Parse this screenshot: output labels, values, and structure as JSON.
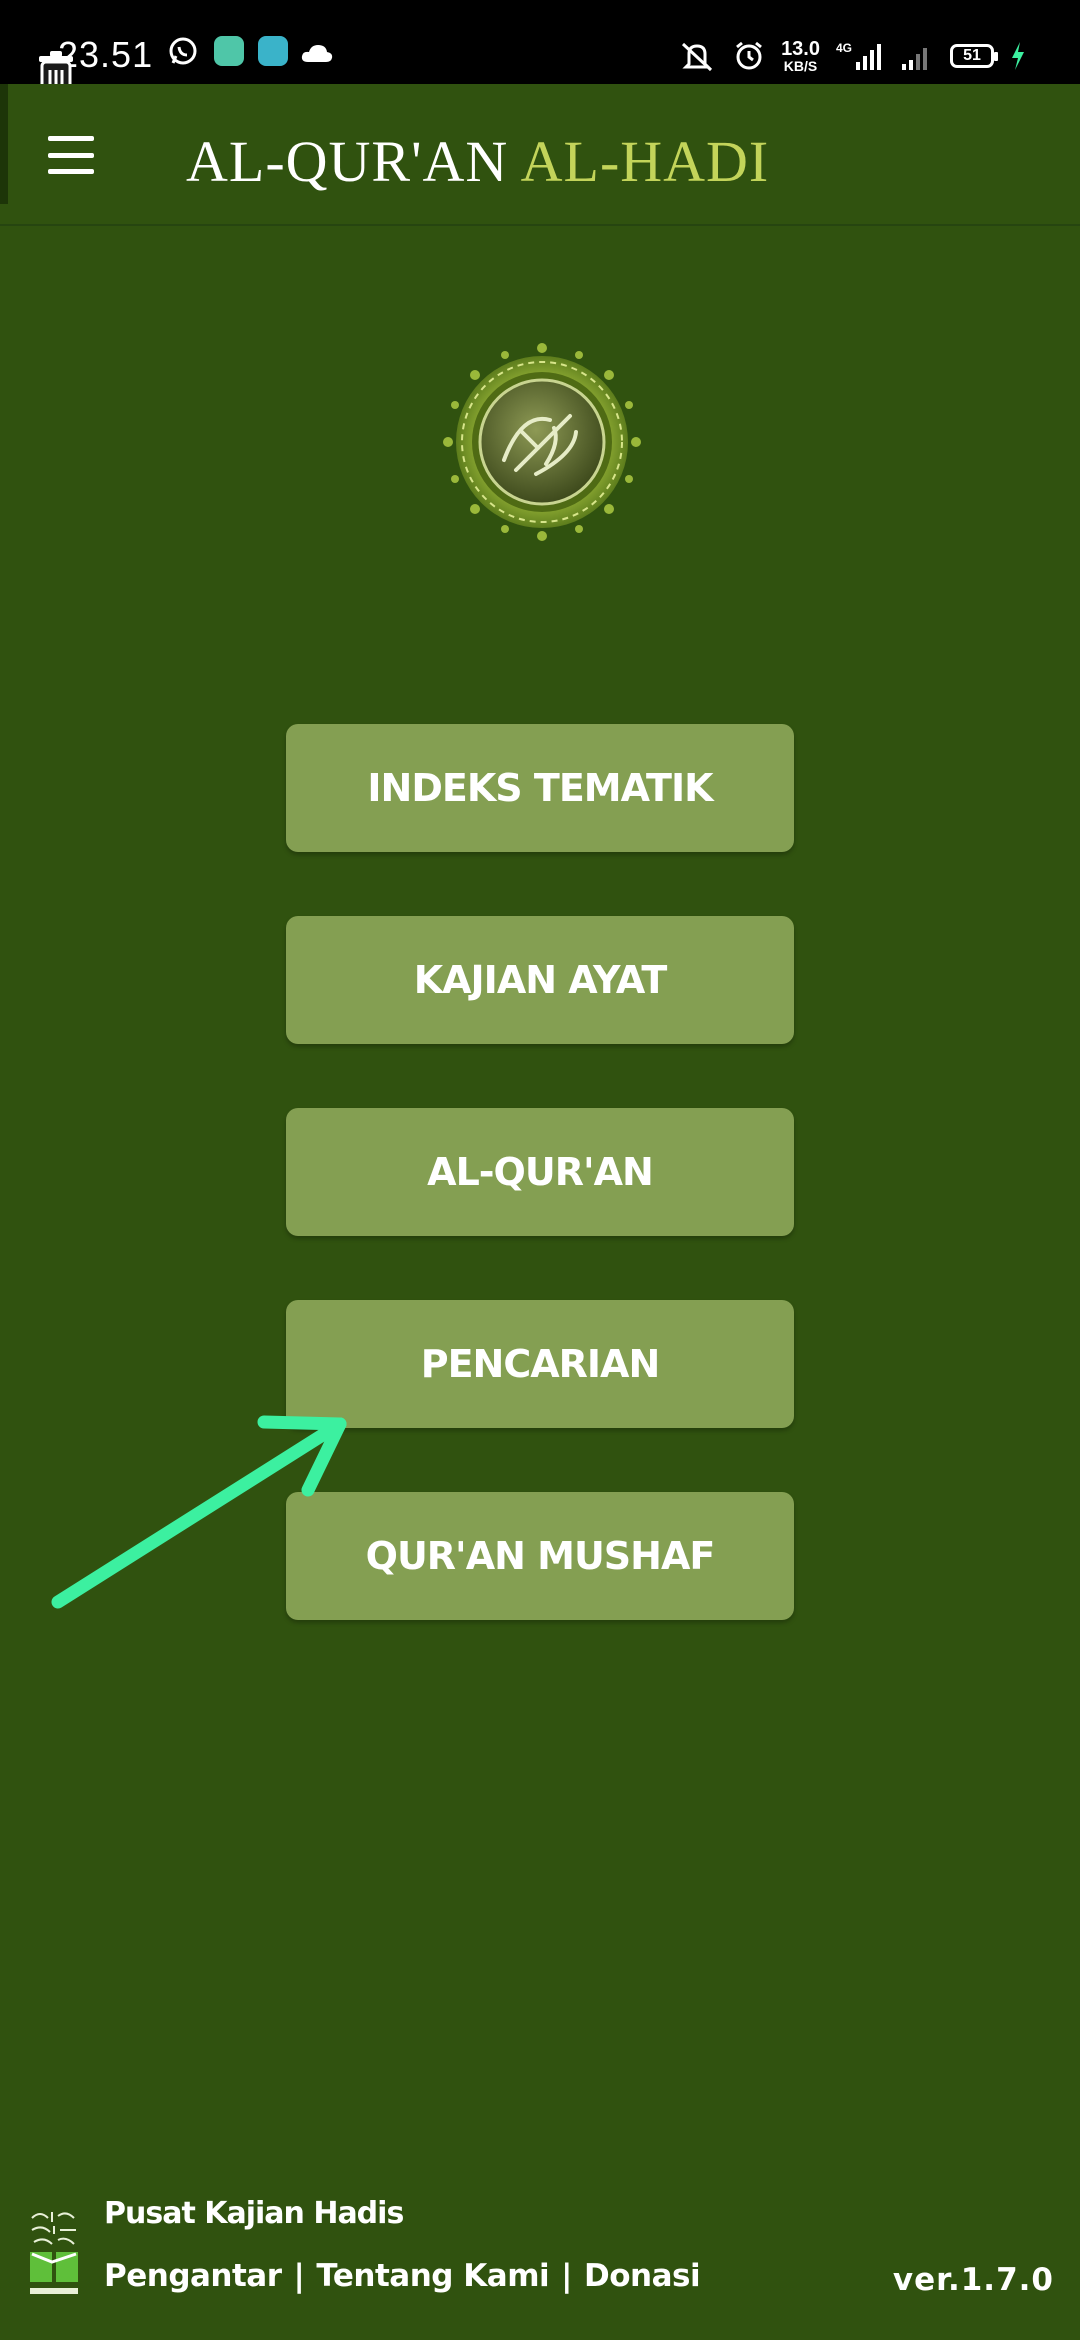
{
  "status_bar": {
    "time": "23.51",
    "net_speed_value": "13.0",
    "net_speed_unit": "KB/S",
    "network_type": "4G",
    "battery_level": "51",
    "icons": [
      "whatsapp-icon",
      "app-notification-icon",
      "chat-notification-icon",
      "cloud-icon",
      "trash-icon",
      "mute-icon",
      "alarm-icon",
      "signal-icon",
      "battery-icon",
      "charging-icon"
    ]
  },
  "app_bar": {
    "title_main": "AL-QUR'AN",
    "title_accent": "AL-HADI",
    "menu_icon": "hamburger-menu-icon"
  },
  "logo": {
    "icon": "quran-calligraphy-logo"
  },
  "menu": {
    "items": [
      {
        "label": "INDEKS TEMATIK"
      },
      {
        "label": "KAJIAN AYAT"
      },
      {
        "label": "AL-QUR'AN"
      },
      {
        "label": "PENCARIAN"
      },
      {
        "label": "QUR'AN MUSHAF"
      }
    ]
  },
  "footer": {
    "org_name": "Pusat Kajian Hadis",
    "links": [
      "Pengantar",
      "Tentang Kami",
      "Donasi"
    ],
    "separator": "|",
    "version": "ver.1.7.0"
  },
  "colors": {
    "background": "#30520f",
    "button": "#849f52",
    "title_accent": "#c3d45a",
    "annotation_arrow": "#3cf0a0"
  }
}
